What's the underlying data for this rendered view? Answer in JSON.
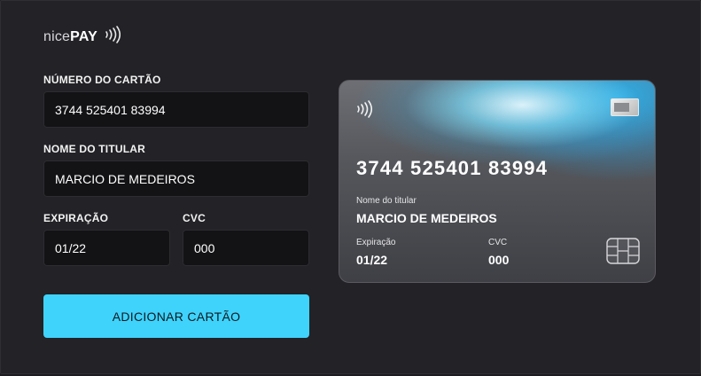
{
  "brand": {
    "light": "nice",
    "bold": "PAY"
  },
  "form": {
    "number_label": "NÚMERO DO CARTÃO",
    "number_value": "3744 525401 83994",
    "holder_label": "NOME DO TITULAR",
    "holder_value": "MARCIO DE MEDEIROS",
    "expiry_label": "EXPIRAÇÃO",
    "expiry_value": "01/22",
    "cvc_label": "CVC",
    "cvc_value": "000",
    "submit_label": "ADICIONAR CARTÃO"
  },
  "card": {
    "number": "3744 525401 83994",
    "holder_caption": "Nome do titular",
    "holder": "MARCIO DE MEDEIROS",
    "expiry_caption": "Expiração",
    "expiry": "01/22",
    "cvc_caption": "CVC",
    "cvc": "000",
    "brand_icon": "amex-card-icon",
    "contactless_icon": "contactless-icon",
    "chip_icon": "chip-icon"
  },
  "colors": {
    "accent": "#3fd3fb",
    "background": "#222227",
    "input_bg": "#131316"
  }
}
